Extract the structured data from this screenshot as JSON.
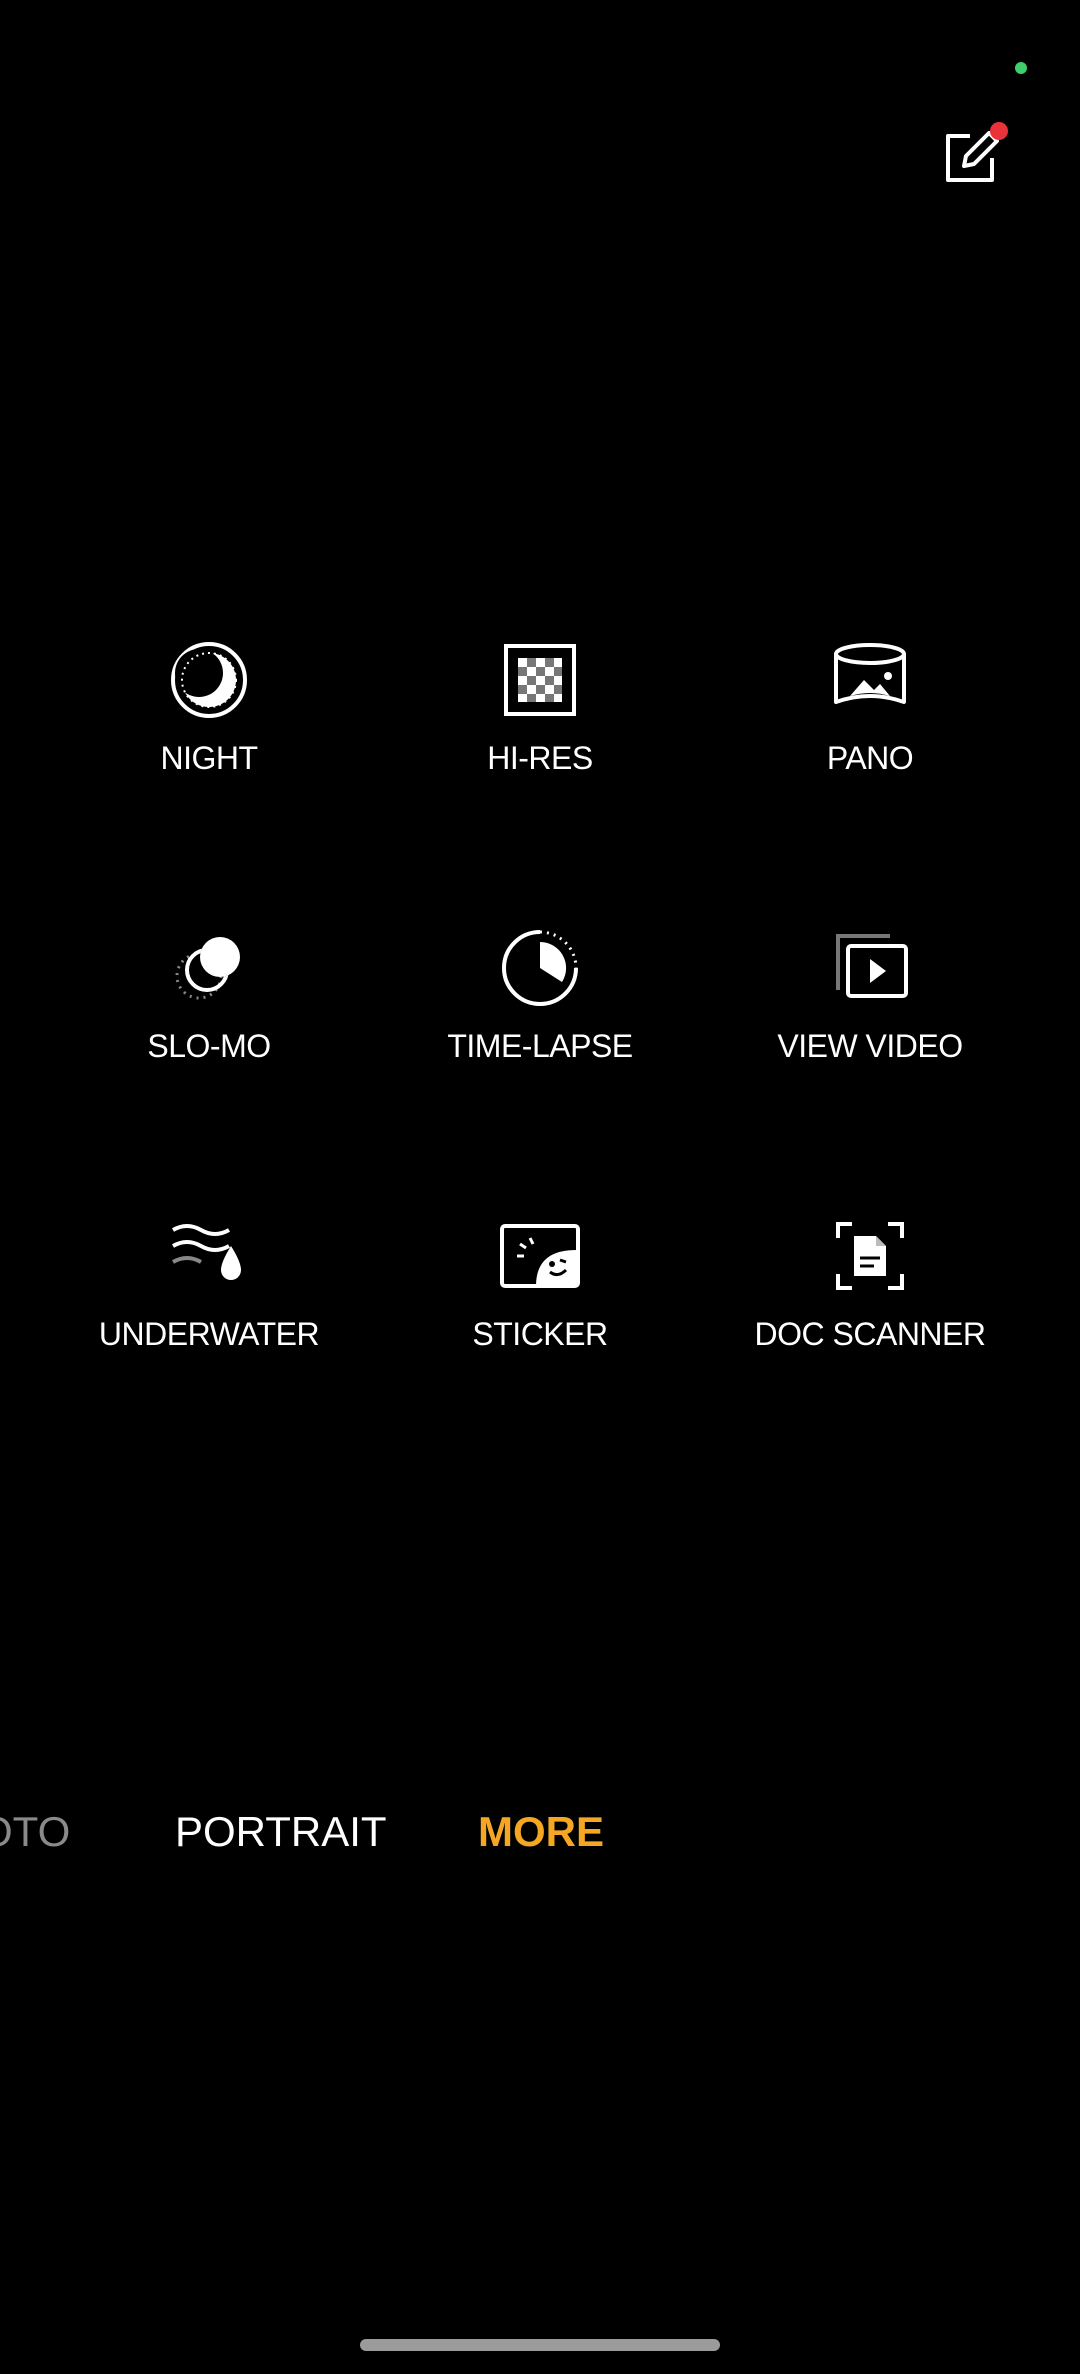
{
  "modes": [
    {
      "key": "night",
      "label": "NIGHT",
      "icon": "night-icon"
    },
    {
      "key": "hi-res",
      "label": "HI-RES",
      "icon": "hi-res-icon"
    },
    {
      "key": "pano",
      "label": "PANO",
      "icon": "pano-icon"
    },
    {
      "key": "slo-mo",
      "label": "SLO-MO",
      "icon": "slo-mo-icon"
    },
    {
      "key": "time-lapse",
      "label": "TIME-LAPSE",
      "icon": "time-lapse-icon"
    },
    {
      "key": "view-video",
      "label": "VIEW VIDEO",
      "icon": "view-video-icon"
    },
    {
      "key": "underwater",
      "label": "UNDERWATER",
      "icon": "underwater-icon"
    },
    {
      "key": "sticker",
      "label": "STICKER",
      "icon": "sticker-icon"
    },
    {
      "key": "doc-scanner",
      "label": "DOC SCANNER",
      "icon": "doc-scanner-icon"
    }
  ],
  "mode_bar": {
    "photo": "OTO",
    "portrait": "PORTRAIT",
    "more": "MORE",
    "active": "MORE"
  },
  "colors": {
    "background": "#000000",
    "accent": "#f5a623",
    "status_dot": "#3ecf6a",
    "badge": "#e8333a"
  }
}
